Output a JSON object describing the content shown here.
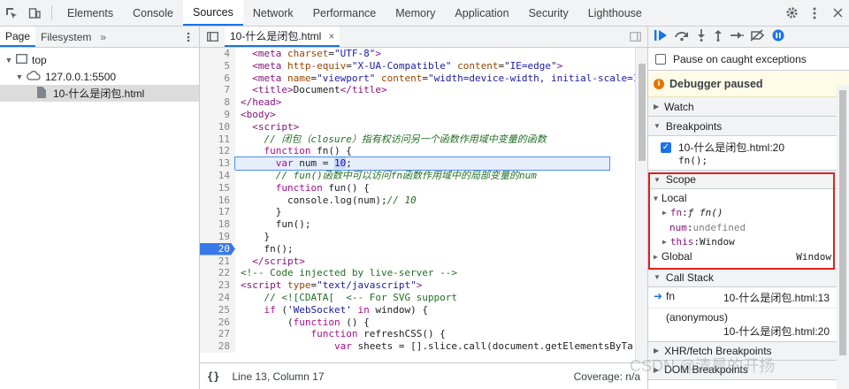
{
  "toolbar": {
    "tabs": [
      "Elements",
      "Console",
      "Sources",
      "Network",
      "Performance",
      "Memory",
      "Application",
      "Security",
      "Lighthouse"
    ],
    "active_tab": "Sources"
  },
  "navigator": {
    "tabs": [
      "Page",
      "Filesystem"
    ],
    "more": "»",
    "tree": {
      "top": "top",
      "host": "127.0.0.1:5500",
      "file": "10-什么是闭包.html"
    }
  },
  "editor": {
    "tab_label": "10-什么是闭包.html",
    "status": "Line 13, Column 17",
    "coverage": "Coverage: n/a",
    "lines": [
      {
        "n": "4"
      },
      {
        "n": "5"
      },
      {
        "n": "6"
      },
      {
        "n": "7"
      },
      {
        "n": "8"
      },
      {
        "n": "9"
      },
      {
        "n": "10"
      },
      {
        "n": "11"
      },
      {
        "n": "12"
      },
      {
        "n": "13"
      },
      {
        "n": "14"
      },
      {
        "n": "15"
      },
      {
        "n": "16"
      },
      {
        "n": "17"
      },
      {
        "n": "18"
      },
      {
        "n": "19"
      },
      {
        "n": "20"
      },
      {
        "n": "21"
      },
      {
        "n": "22"
      },
      {
        "n": "23"
      },
      {
        "n": "24"
      },
      {
        "n": "25"
      },
      {
        "n": "26"
      },
      {
        "n": "27"
      },
      {
        "n": "28"
      }
    ]
  },
  "debugger": {
    "pause_on_caught": "Pause on caught exceptions",
    "paused_banner": "Debugger paused",
    "watch": "Watch",
    "breakpoints": "Breakpoints",
    "bp_file": "10-什么是闭包.html:20",
    "bp_code": "fn();",
    "scope": "Scope",
    "local": "Local",
    "vars": {
      "fn_key": "fn",
      "fn_val": "ƒ fn()",
      "num_key": "num",
      "num_val": "undefined",
      "this_key": "this",
      "this_val": "Window"
    },
    "global": "Global",
    "global_val": "Window",
    "call_stack": "Call Stack",
    "frames": [
      {
        "name": "fn",
        "loc": "10-什么是闭包.html:13"
      },
      {
        "name": "(anonymous)",
        "loc": "10-什么是闭包.html:20"
      }
    ],
    "xhr": "XHR/fetch Breakpoints",
    "dom": "DOM Breakpoints"
  },
  "watermark": "CSDN @清晨的开扬"
}
